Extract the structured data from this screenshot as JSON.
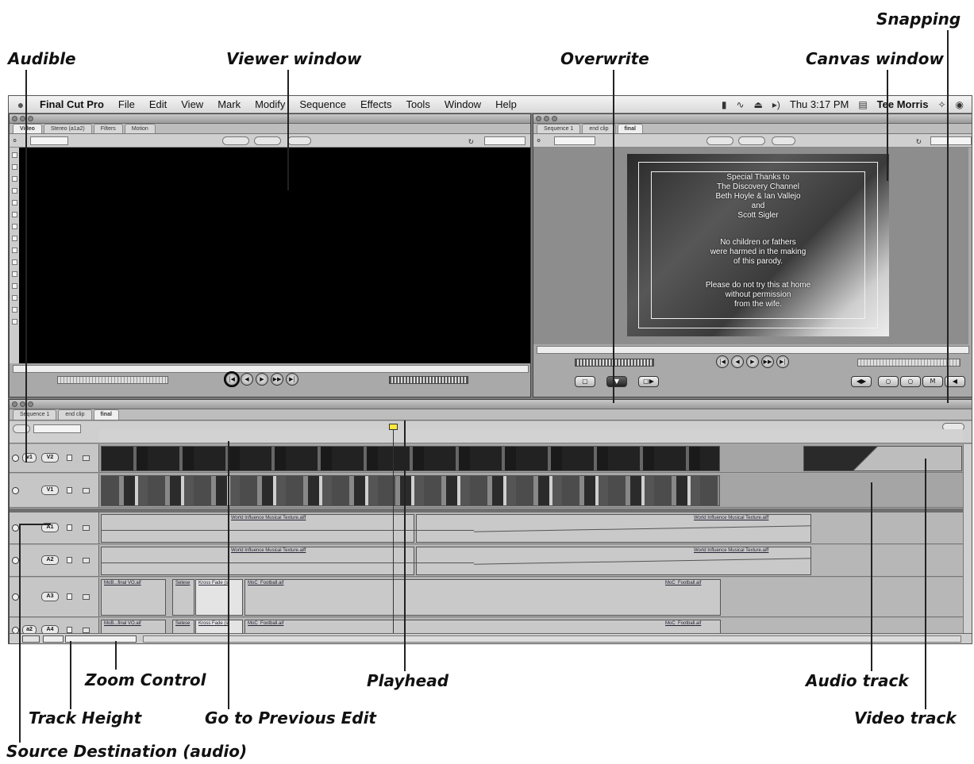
{
  "callouts": {
    "snapping": "Snapping",
    "audible": "Audible",
    "viewer_window": "Viewer window",
    "overwrite": "Overwrite",
    "canvas_window": "Canvas window",
    "zoom_control": "Zoom Control",
    "playhead": "Playhead",
    "audio_track": "Audio track",
    "track_height": "Track Height",
    "go_to_previous_edit": "Go to Previous Edit",
    "video_track": "Video track",
    "source_destination_audio": "Source Destination (audio)"
  },
  "menubar": {
    "app": "Final Cut Pro",
    "items": [
      "File",
      "Edit",
      "View",
      "Mark",
      "Modify",
      "Sequence",
      "Effects",
      "Tools",
      "Window",
      "Help"
    ],
    "clock": "Thu 3:17 PM",
    "user": "Tee Morris"
  },
  "viewer": {
    "tabs": [
      "Video",
      "Stereo (a1a2)",
      "Filters",
      "Motion"
    ]
  },
  "canvas": {
    "tabs": [
      "Sequence 1",
      "end clip",
      "final"
    ],
    "credits": [
      "Special Thanks to",
      "The Discovery Channel",
      "Beth Hoyle & Ian Vallejo",
      "and",
      "Scott Sigler",
      "No children or fathers",
      "were harmed in the making",
      "of this parody.",
      "Please do not try this at home",
      "without permission",
      "from the wife."
    ]
  },
  "timeline": {
    "tabs": [
      "Sequence 1",
      "end clip",
      "final"
    ],
    "tracks": {
      "v2": "V2",
      "v1": "V1",
      "a1_src": "a1",
      "a1": "A1",
      "a2": "A2",
      "a3": "A3",
      "a4_src": "a2",
      "a4": "A4"
    },
    "clips": {
      "music_a1_1": "World Influence Musical Texture.aiff",
      "music_a1_2": "World Influence Musical Texture.aiff",
      "music_a2_1": "World Influence Musical Texture.aiff",
      "music_a2_2": "World Influence Musical Texture.aiff",
      "a3_1": "MoB...final VO.aif",
      "a3_2": "Selese",
      "a3_3": "Kross Fade (s",
      "a3_4": "MoC_Football.aif",
      "a3_5": "MoC_Football.aif",
      "a4_1": "MoB...final VO.aif",
      "a4_2": "Selese",
      "a4_3": "Kross Fade (s",
      "a4_4": "MoC_Football.aif",
      "a4_5": "MoC_Football.aif"
    }
  },
  "colors": {
    "screen_bg": "#7c7c7c",
    "window_chrome": "#a9a9a9",
    "viewer_black": "#000000"
  }
}
